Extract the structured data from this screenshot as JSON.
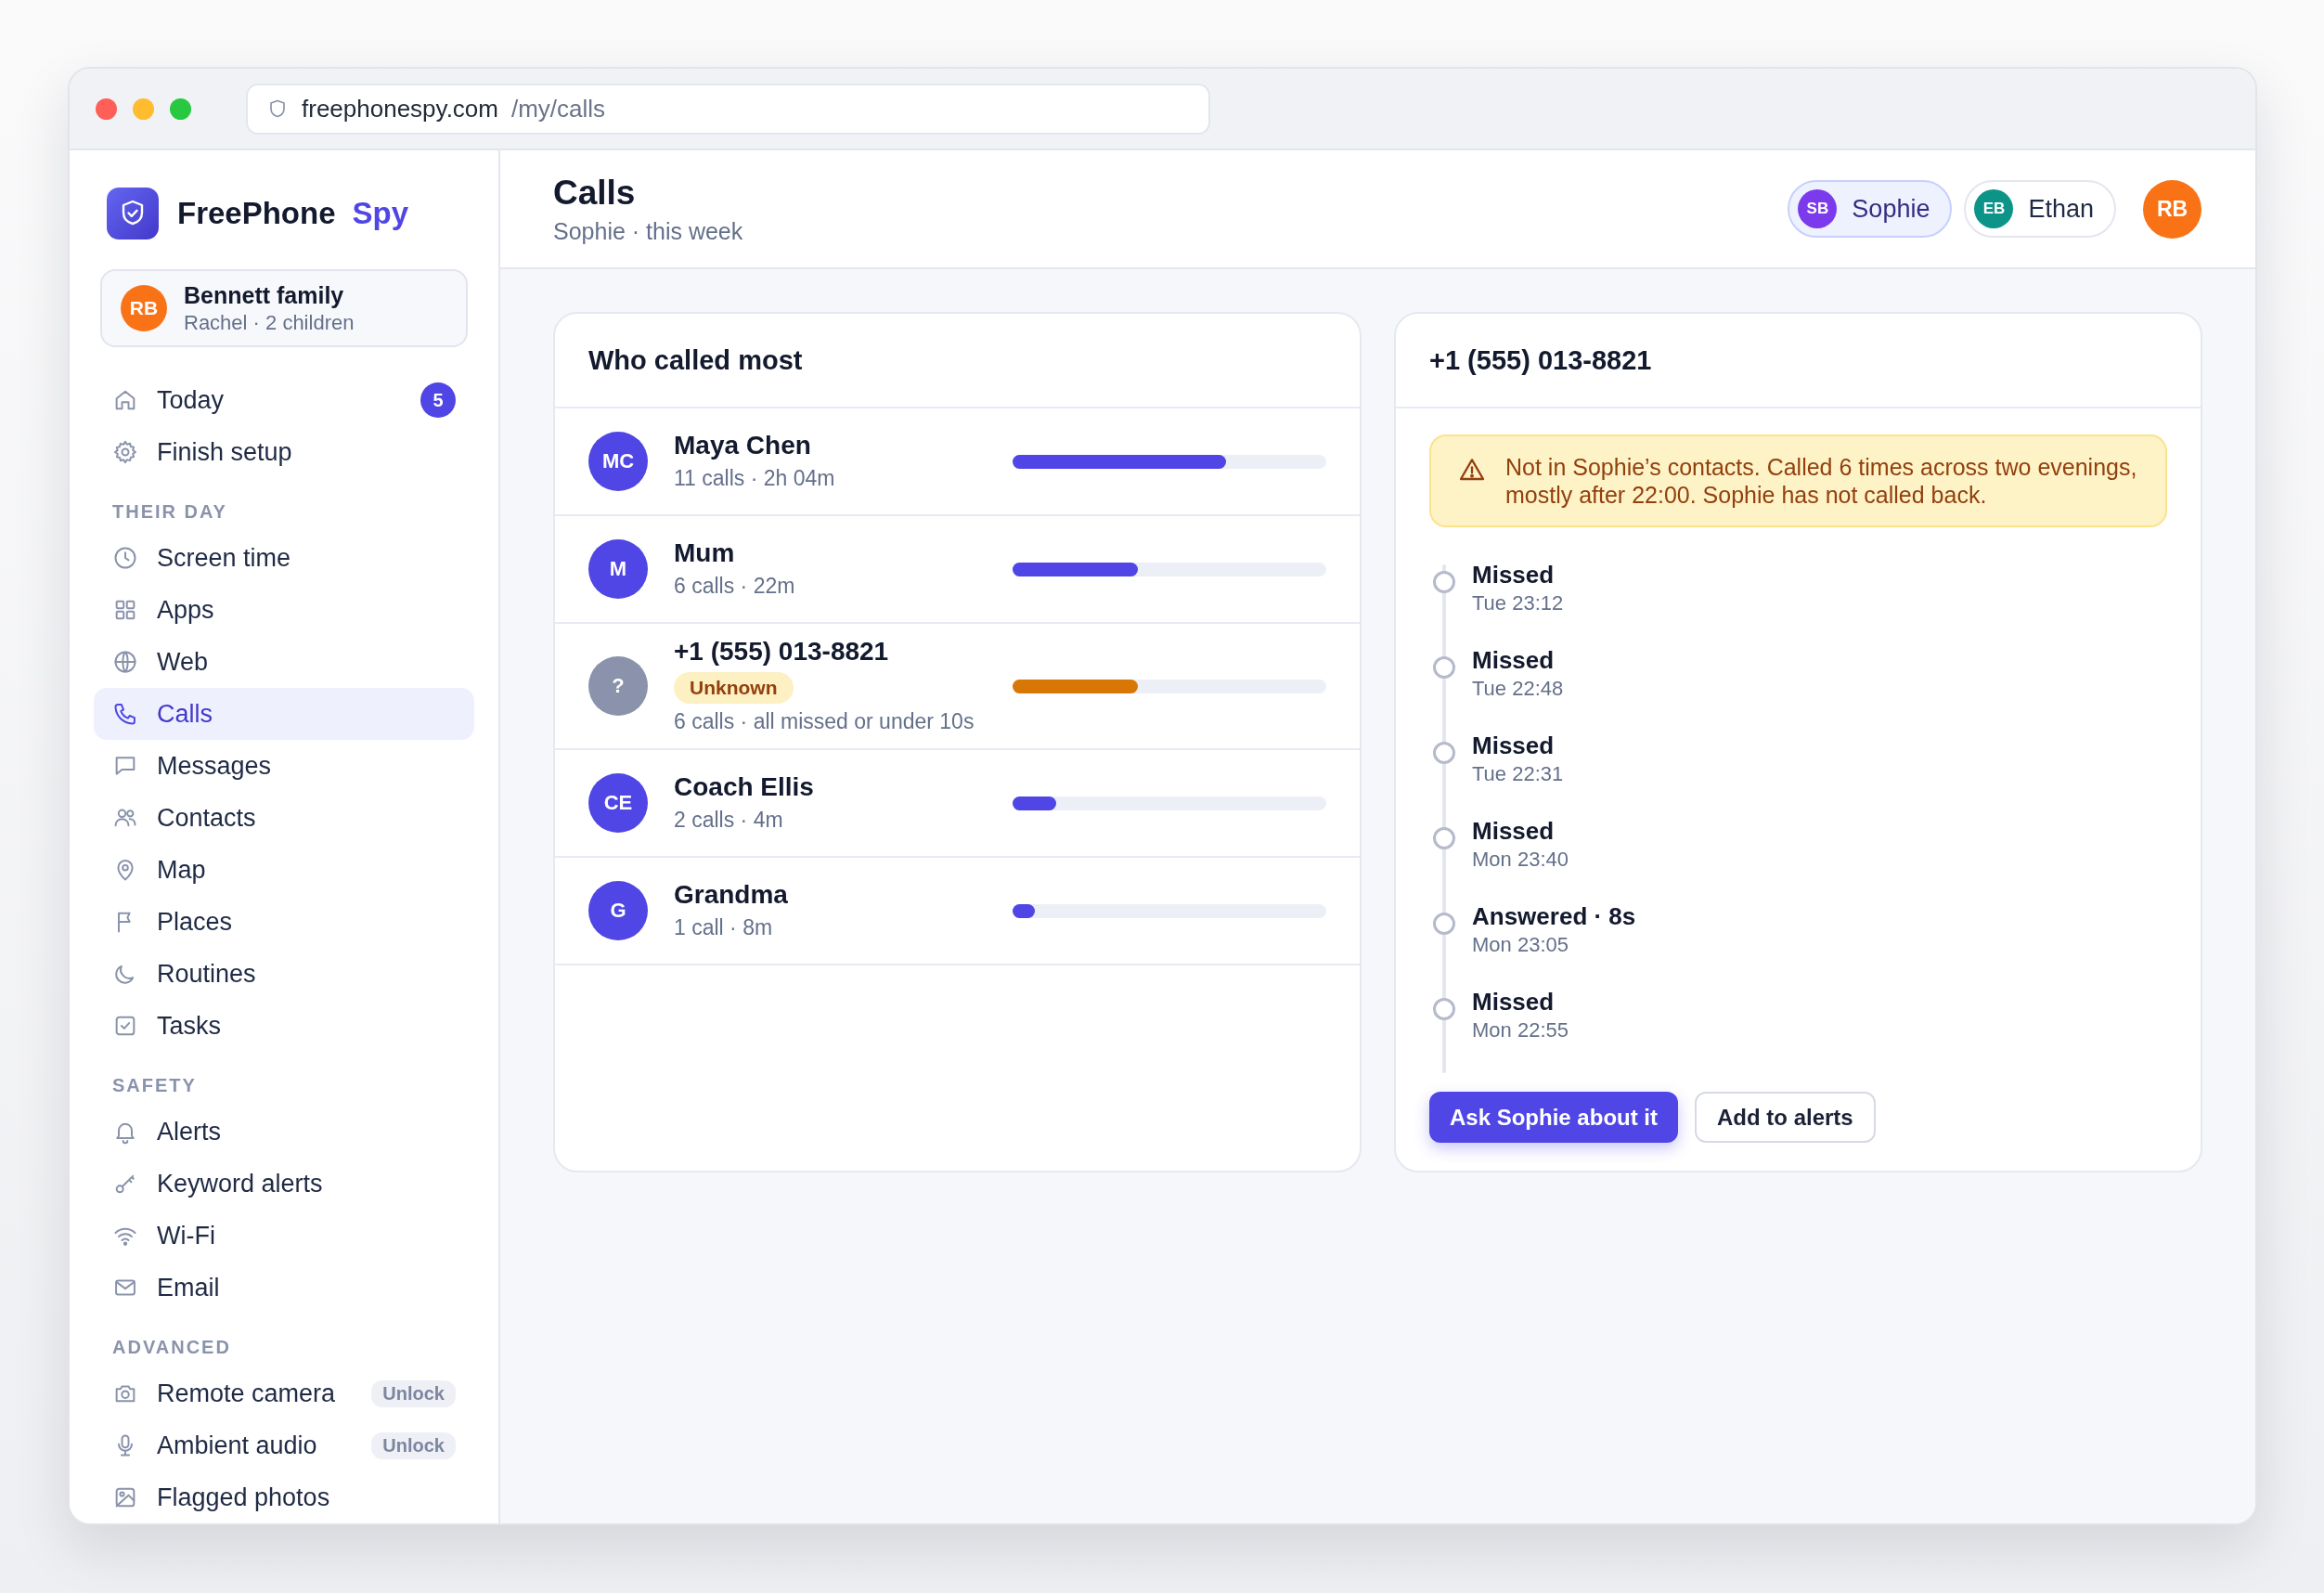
{
  "browser": {
    "domain": "freephonespy.com",
    "path": "/my/calls"
  },
  "sidebar": {
    "brand": {
      "name": "FreePhone",
      "accent": "Spy"
    },
    "family": {
      "initials": "RB",
      "name": "Bennett family",
      "detail": "Rachel · 2 children"
    },
    "sections": [
      {
        "items": [
          {
            "label": "Today",
            "badge": "5",
            "selected": false
          },
          {
            "label": "Finish setup",
            "selected": false
          }
        ]
      },
      {
        "heading": "THEIR DAY",
        "items": [
          {
            "label": "Screen time",
            "selected": false
          },
          {
            "label": "Apps",
            "selected": false
          },
          {
            "label": "Web",
            "selected": false
          },
          {
            "label": "Calls",
            "selected": true
          },
          {
            "label": "Messages",
            "selected": false
          },
          {
            "label": "Contacts",
            "selected": false
          },
          {
            "label": "Map",
            "selected": false
          },
          {
            "label": "Places",
            "selected": false
          },
          {
            "label": "Routines",
            "selected": false
          },
          {
            "label": "Tasks",
            "selected": false
          }
        ]
      },
      {
        "heading": "SAFETY",
        "items": [
          {
            "label": "Alerts",
            "selected": false
          },
          {
            "label": "Keyword alerts",
            "selected": false
          },
          {
            "label": "Wi-Fi",
            "selected": false
          },
          {
            "label": "Email",
            "selected": false
          }
        ]
      },
      {
        "heading": "ADVANCED",
        "items": [
          {
            "label": "Remote camera",
            "tag": "Unlock",
            "selected": false
          },
          {
            "label": "Ambient audio",
            "tag": "Unlock",
            "selected": false
          },
          {
            "label": "Flagged photos",
            "selected": false
          }
        ]
      }
    ]
  },
  "header": {
    "title": "Calls",
    "subtitle": "Sophie · this week",
    "children": [
      {
        "initials": "SB",
        "name": "Sophie",
        "color": "#7c3aed",
        "selected": true
      },
      {
        "initials": "EB",
        "name": "Ethan",
        "color": "#0d9488",
        "selected": false
      }
    ],
    "account": {
      "initials": "RB"
    }
  },
  "top_callers": {
    "title": "Who called most",
    "rows": [
      {
        "kind": "contact",
        "initials": "MC",
        "name": "Maya Chen",
        "detail": "11 calls · 2h 04m",
        "level": 0.68
      },
      {
        "kind": "contact",
        "initials": "M",
        "name": "Mum",
        "detail": "6 calls · 22m",
        "level": 0.4
      },
      {
        "kind": "unknown",
        "initials": "?",
        "name": "+1 (555) 013-8821",
        "tag": "Unknown",
        "detail": "6 calls · all missed or under 10s",
        "level": 0.4
      },
      {
        "kind": "contact",
        "initials": "CE",
        "name": "Coach Ellis",
        "detail": "2 calls · 4m",
        "level": 0.14
      },
      {
        "kind": "contact",
        "initials": "G",
        "name": "Grandma",
        "detail": "1 call · 8m",
        "level": 0.07
      }
    ]
  },
  "detail": {
    "title": "+1 (555) 013-8821",
    "alert": "Not in Sophie’s contacts. Called 6 times across two evenings, mostly after 22:00. Sophie has not called back.",
    "calls": [
      {
        "result": "Missed",
        "time": "Tue 23:12"
      },
      {
        "result": "Missed",
        "time": "Tue 22:48"
      },
      {
        "result": "Missed",
        "time": "Tue 22:31"
      },
      {
        "result": "Missed",
        "time": "Mon 23:40"
      },
      {
        "result": "Answered · 8s",
        "time": "Mon 23:05"
      },
      {
        "result": "Missed",
        "time": "Mon 22:55"
      }
    ],
    "buttons": [
      {
        "kind": "primary",
        "label": "Ask Sophie about it"
      },
      {
        "kind": "secondary",
        "label": "Add to alerts"
      }
    ]
  }
}
